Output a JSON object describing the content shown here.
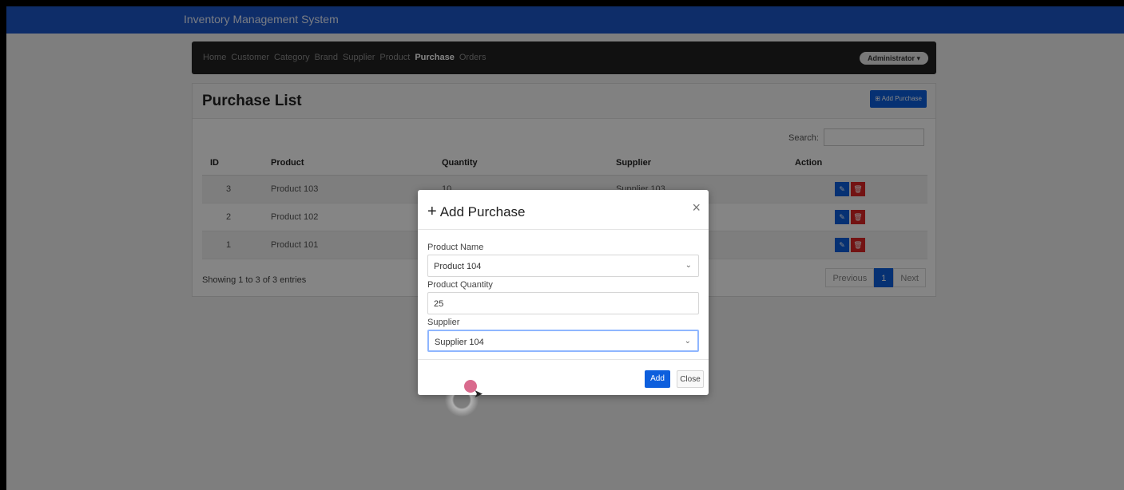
{
  "app": {
    "title": "Inventory Management System"
  },
  "nav": {
    "items": [
      "Home",
      "Customer",
      "Category",
      "Brand",
      "Supplier",
      "Product",
      "Purchase",
      "Orders"
    ],
    "active": "Purchase",
    "user_label": "Administrator ▾"
  },
  "purchase_list": {
    "title": "Purchase List",
    "add_button_label": "⊞ Add Purchase",
    "search_label": "Search:",
    "columns": [
      "ID",
      "Product",
      "Quantity",
      "Supplier",
      "Action"
    ],
    "rows": [
      {
        "id": "3",
        "product": "Product 103",
        "quantity": "10",
        "supplier": "Supplier 103"
      },
      {
        "id": "2",
        "product": "Product 102",
        "quantity": "",
        "supplier": ""
      },
      {
        "id": "1",
        "product": "Product 101",
        "quantity": "",
        "supplier": ""
      }
    ],
    "showing_text": "Showing 1 to 3 of 3 entries",
    "pagination": {
      "previous": "Previous",
      "current_page": "1",
      "next": "Next"
    }
  },
  "modal": {
    "title": "Add Purchase",
    "fields": {
      "product_name_label": "Product Name",
      "product_name_value": "Product 104",
      "product_quantity_label": "Product Quantity",
      "product_quantity_value": "25",
      "supplier_label": "Supplier",
      "supplier_value": "Supplier 104"
    },
    "add_label": "Add",
    "close_label": "Close"
  },
  "colors": {
    "topbar": "#1c57c9",
    "primary": "#0d5fdd",
    "danger": "#dc2626"
  }
}
